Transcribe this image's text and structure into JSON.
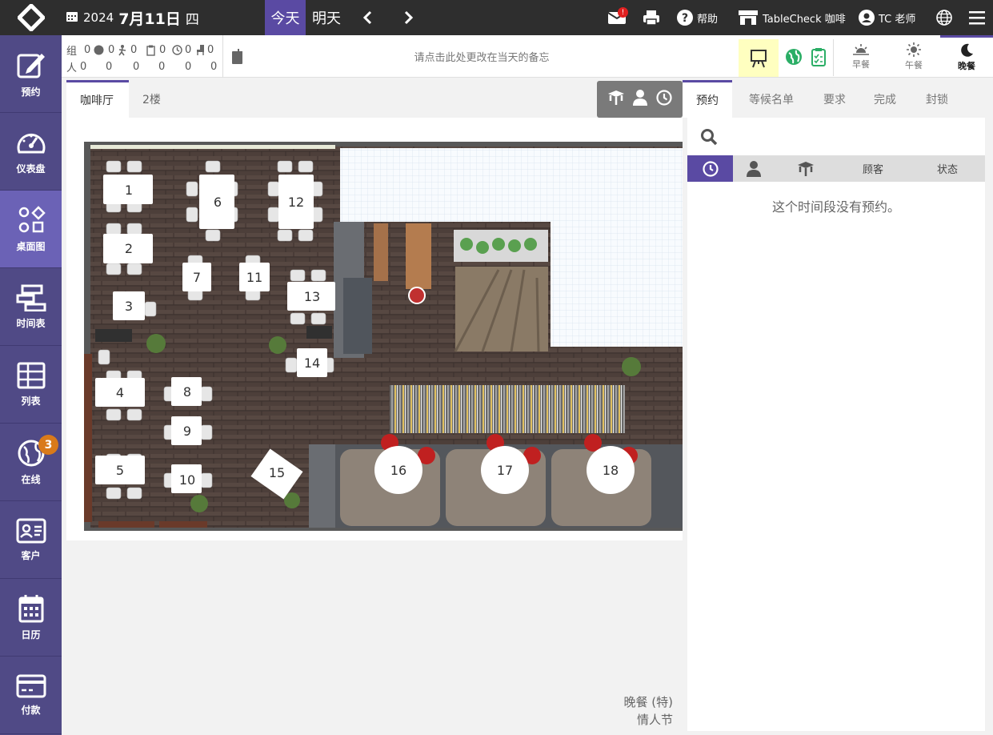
{
  "topbar": {
    "year": "2024",
    "month_day": "7月11日",
    "weekday": "四",
    "today_label": "今天",
    "tomorrow_label": "明天",
    "mail_badge": "!",
    "help_label": "帮助",
    "store_label": "TableCheck 咖啡",
    "user_label": "TC 老师"
  },
  "sidebar": {
    "items": [
      {
        "label": "预约",
        "icon": "edit-icon"
      },
      {
        "label": "仪表盘",
        "icon": "gauge-icon"
      },
      {
        "label": "桌面图",
        "icon": "floor-plan-icon"
      },
      {
        "label": "时间表",
        "icon": "timeline-icon"
      },
      {
        "label": "列表",
        "icon": "list-icon"
      },
      {
        "label": "在线",
        "icon": "globe-icon",
        "badge": "3"
      },
      {
        "label": "客户",
        "icon": "customer-card-icon"
      },
      {
        "label": "日历",
        "icon": "calendar-icon"
      },
      {
        "label": "付款",
        "icon": "credit-card-icon"
      }
    ]
  },
  "statusbar": {
    "group_label": "组",
    "people_label": "人",
    "group_values": [
      "0",
      "0",
      "0",
      "0",
      "0",
      "0"
    ],
    "people_values": [
      "0",
      "0",
      "0",
      "0",
      "0",
      "0"
    ],
    "memo_placeholder": "请点击此处更改在当天的备忘"
  },
  "meals": [
    {
      "label": "早餐",
      "icon": "sunrise-icon"
    },
    {
      "label": "午餐",
      "icon": "sun-icon"
    },
    {
      "label": "晚餐",
      "icon": "moon-icon"
    }
  ],
  "floor_tabs": [
    "咖啡厅",
    "2楼"
  ],
  "floor_tables": [
    "1",
    "2",
    "3",
    "4",
    "5",
    "6",
    "7",
    "8",
    "9",
    "10",
    "11",
    "12",
    "13",
    "14",
    "15",
    "16",
    "17",
    "18"
  ],
  "shift_info": {
    "line1": "晚餐 (特)",
    "line2": "情人节"
  },
  "right_panel": {
    "tabs": [
      "预约",
      "等候名单",
      "要求",
      "完成",
      "封锁"
    ],
    "columns": {
      "customer": "顾客",
      "status": "状态"
    },
    "empty_message": "这个时间段没有预约。"
  },
  "colors": {
    "accent": "#5a4aa3",
    "sidebar": "#504a86",
    "topbar": "#2e2e2e",
    "badge": "#d97a1a"
  }
}
